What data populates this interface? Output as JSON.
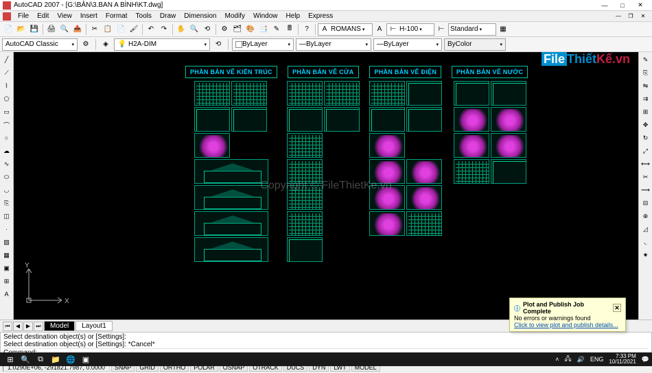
{
  "title": "AutoCAD 2007 - [G:\\BẢN\\3.BAN  A BÌNH\\KT.dwg]",
  "menu": [
    "File",
    "Edit",
    "View",
    "Insert",
    "Format",
    "Tools",
    "Draw",
    "Dimension",
    "Modify",
    "Window",
    "Help",
    "Express"
  ],
  "toolbar": {
    "workspace": "AutoCAD Classic",
    "layer": "H2A-DIM",
    "font": "ROMANS",
    "scale": "H-100",
    "dimstyle": "Standard",
    "color": "ByLayer",
    "linetype": "ByLayer",
    "lineweight": "ByLayer",
    "plotstyle": "ByColor"
  },
  "sections": [
    {
      "title": "PHẦN BẢN VẼ KIẾN TRÚC"
    },
    {
      "title": "PHẦN BẢN VẼ CỬA"
    },
    {
      "title": "PHẦN BẢN VẼ ĐIỆN"
    },
    {
      "title": "PHẦN BẢN VẼ NƯỚC"
    }
  ],
  "tabs": {
    "model": "Model",
    "layout1": "Layout1"
  },
  "command": {
    "line1": "Select destination object(s) or [Settings]:",
    "line2": "Select destination object(s) or [Settings]: *Cancel*",
    "prompt": "Command:"
  },
  "status": {
    "coords": "1.0290E+06, -291821.7987, 0.0000",
    "toggles": [
      "SNAP",
      "GRID",
      "ORTHO",
      "POLAR",
      "OSNAP",
      "OTRACK",
      "DUCS",
      "DYN",
      "LWT",
      "MODEL"
    ]
  },
  "notif": {
    "title": "Plot and Publish Job Complete",
    "msg": "No errors or warnings found",
    "link": "Click to view plot and publish details..."
  },
  "watermark": {
    "logo_pre": "File",
    "logo_mid": "Thiết",
    "logo_suf": "Kế.vn",
    "center": "Copyright © FileThietKe.vn"
  },
  "taskbar": {
    "lang": "ENG",
    "time": "7:33 PM",
    "date": "10/11/2021"
  }
}
